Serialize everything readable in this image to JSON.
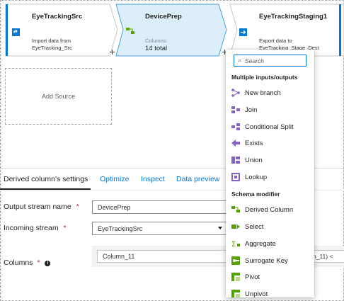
{
  "pipeline": {
    "source_node": {
      "title": "EyeTrackingSrc",
      "description_line1": "Import data from",
      "description_line2": "EyeTracking_Src"
    },
    "prep_node": {
      "title": "DevicePrep",
      "columns_label": "Columns:",
      "columns_total": "14 total"
    },
    "sink_node": {
      "title": "EyeTrackingStaging1",
      "description_line1": "Export data to",
      "description_line2": "EyeTracking_Stage_Dest"
    },
    "plus_label": "+",
    "add_source_label": "Add Source"
  },
  "settings": {
    "tabs": [
      {
        "label": "Derived column's settings"
      },
      {
        "label": "Optimize"
      },
      {
        "label": "Inspect"
      },
      {
        "label": "Data preview"
      }
    ],
    "output_stream": {
      "label": "Output stream name",
      "required_mark": "*",
      "value": "DevicePrep"
    },
    "incoming_stream": {
      "label": "Incoming stream",
      "required_mark": "*",
      "value": "EyeTrackingSrc"
    },
    "columns": {
      "label": "Columns",
      "required_mark": "*",
      "info_glyph": "i",
      "column_name": "Column_11",
      "expression_fragment": "n_11) <"
    }
  },
  "menu": {
    "search_placeholder": "Search",
    "sections": [
      {
        "title": "Multiple inputs/outputs",
        "items": [
          {
            "label": "New branch",
            "icon": "new-branch-icon"
          },
          {
            "label": "Join",
            "icon": "join-icon"
          },
          {
            "label": "Conditional Split",
            "icon": "conditional-split-icon"
          },
          {
            "label": "Exists",
            "icon": "exists-icon"
          },
          {
            "label": "Union",
            "icon": "union-icon"
          },
          {
            "label": "Lookup",
            "icon": "lookup-icon"
          }
        ]
      },
      {
        "title": "Schema modifier",
        "items": [
          {
            "label": "Derived Column",
            "icon": "derived-column-icon"
          },
          {
            "label": "Select",
            "icon": "select-icon"
          },
          {
            "label": "Aggregate",
            "icon": "aggregate-icon"
          },
          {
            "label": "Surrogate Key",
            "icon": "surrogate-key-icon"
          },
          {
            "label": "Pivot",
            "icon": "pivot-icon"
          },
          {
            "label": "Unpivot",
            "icon": "unpivot-icon"
          }
        ]
      }
    ]
  },
  "colors": {
    "accent_blue": "#0078d4",
    "selected_node_fill": "#dceefa",
    "purple_icon": "#8661c5",
    "green_icon": "#57a300"
  }
}
